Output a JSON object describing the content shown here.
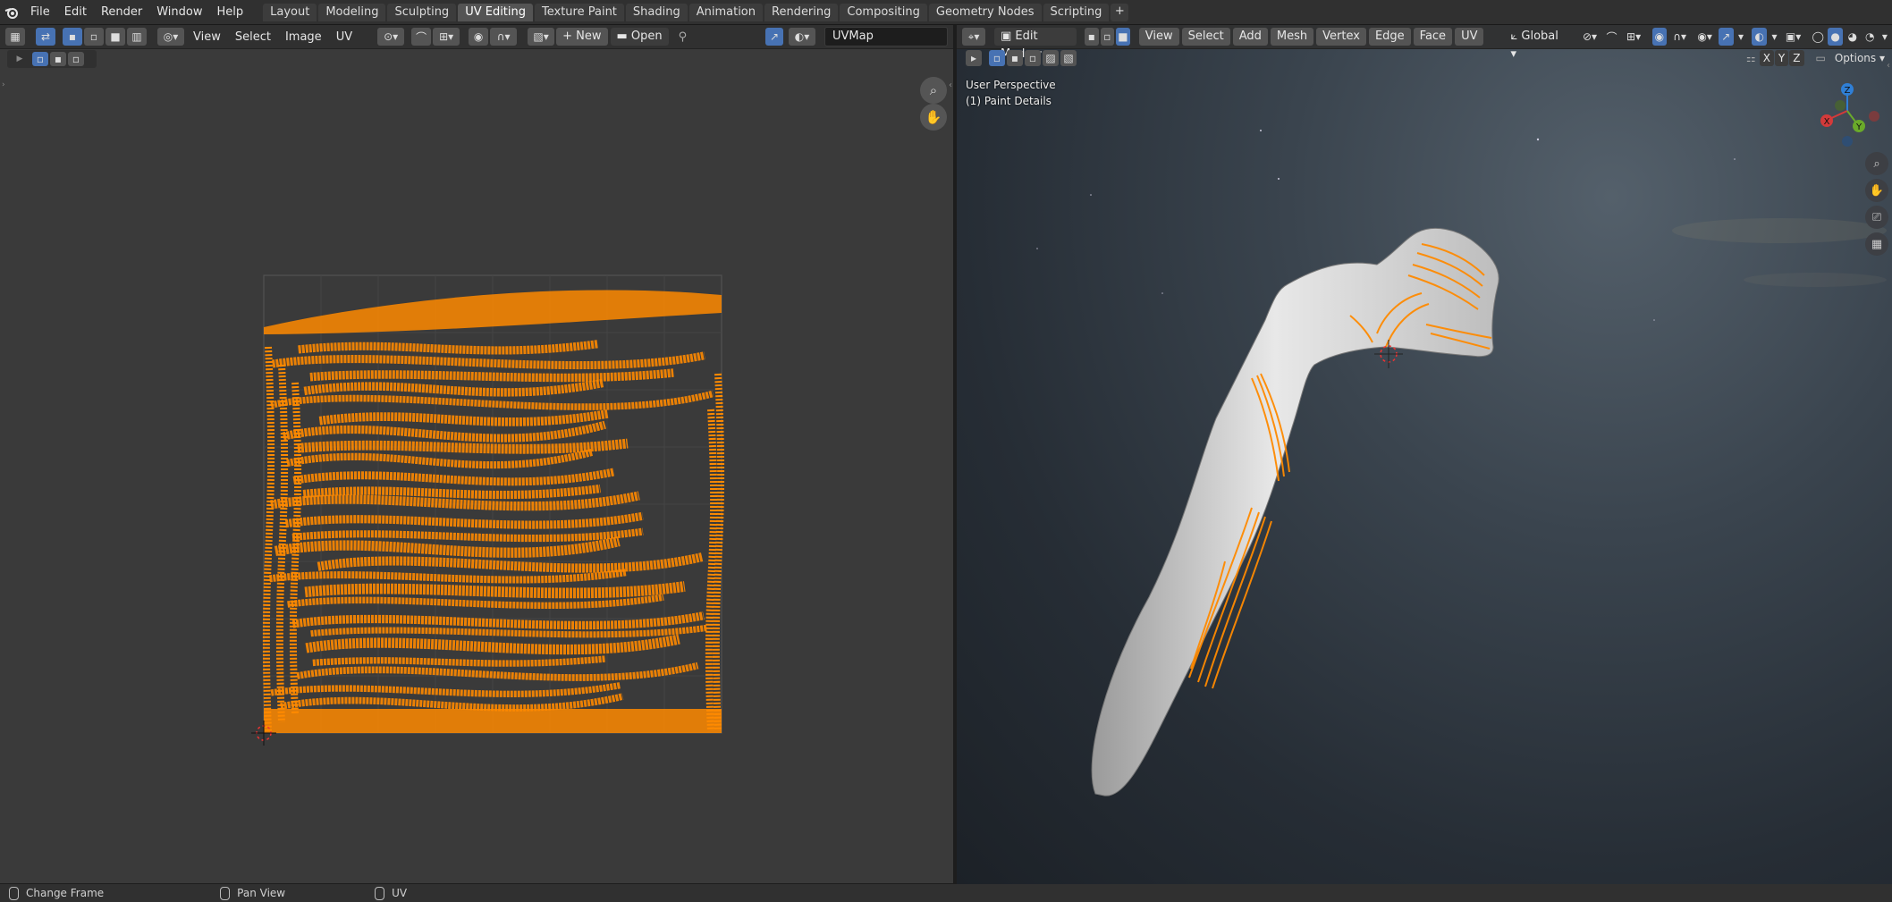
{
  "topbar": {
    "menus": [
      "File",
      "Edit",
      "Render",
      "Window",
      "Help"
    ],
    "workspaces": [
      "Layout",
      "Modeling",
      "Sculpting",
      "UV Editing",
      "Texture Paint",
      "Shading",
      "Animation",
      "Rendering",
      "Compositing",
      "Geometry Nodes",
      "Scripting"
    ],
    "active_workspace": "UV Editing",
    "add_label": "+"
  },
  "uv_editor": {
    "menus": [
      "View",
      "Select",
      "Image",
      "UV"
    ],
    "new_label": "New",
    "open_label": "Open",
    "uvmap_value": "UVMap",
    "uv_color": "#ff8a00",
    "bg_color": "#3a3a3a"
  },
  "viewport": {
    "mode": "Edit Mode",
    "menus": [
      "View",
      "Select",
      "Add",
      "Mesh",
      "Vertex",
      "Edge",
      "Face",
      "UV"
    ],
    "transform_orientation": "Global",
    "options_label": "Options",
    "axis_x": "X",
    "axis_y": "Y",
    "axis_z": "Z",
    "overlay_line1": "User Perspective",
    "overlay_line2": "(1) Paint Details",
    "gizmo": {
      "x": "X",
      "y": "Y",
      "z": "Z"
    }
  },
  "statusbar": {
    "item1": "Change Frame",
    "item2": "Pan View",
    "item3": "UV"
  }
}
